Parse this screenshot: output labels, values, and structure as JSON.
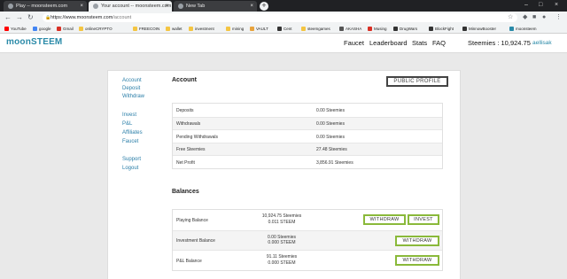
{
  "browser": {
    "tabs": [
      {
        "title": "Play -- moonsteem.com",
        "active": false
      },
      {
        "title": "Your account -- moonsteem.com",
        "active": true
      },
      {
        "title": "New Tab",
        "active": false
      }
    ],
    "url_host": "https://www.moonsteem.com",
    "url_path": "/account",
    "bookmarks": [
      {
        "label": "YouTube",
        "color": "#ff0000"
      },
      {
        "label": "google",
        "color": "#4285f4"
      },
      {
        "label": "Gmail",
        "color": "#d93025"
      },
      {
        "label": "onlineCRYPTO",
        "color": "#f4c542"
      },
      {
        "label": "FREECOIN",
        "color": "#f4c542"
      },
      {
        "label": "wallet",
        "color": "#f4c542"
      },
      {
        "label": "investment",
        "color": "#f4c542"
      },
      {
        "label": "mining",
        "color": "#f4c542"
      },
      {
        "label": "VAULT",
        "color": "#e8a33d"
      },
      {
        "label": "Cent",
        "color": "#333333"
      },
      {
        "label": "steemgames",
        "color": "#f4c542"
      },
      {
        "label": "AKASHA",
        "color": "#555555"
      },
      {
        "label": "Musing",
        "color": "#d93025"
      },
      {
        "label": "DrugWars",
        "color": "#333333"
      },
      {
        "label": "BlockFight",
        "color": "#333333"
      },
      {
        "label": "MinnowBooster",
        "color": "#333333"
      },
      {
        "label": "moonsteem",
        "color": "#2a8aa8"
      }
    ]
  },
  "site": {
    "logo": "moonSTEEM",
    "nav": [
      "Faucet",
      "Leaderboard",
      "Stats",
      "FAQ"
    ],
    "balance": "Steemies : 10,924.75",
    "username": "aellisak",
    "accent": "#2a8aa8"
  },
  "sidebar": {
    "group1": [
      "Account",
      "Deposit",
      "Withdraw"
    ],
    "group2": [
      "Invest",
      "P&L",
      "Affiliates",
      "Faucet"
    ],
    "group3": [
      "Support",
      "Logout"
    ]
  },
  "account": {
    "title": "Account",
    "public_profile": "PUBLIC PROFILE",
    "rows": [
      {
        "label": "Deposits",
        "value": "0.00 Steemies"
      },
      {
        "label": "Withdrawals",
        "value": "0.00 Steemies"
      },
      {
        "label": "Pending Withdrawals",
        "value": "0.00 Steemies"
      },
      {
        "label": "Free Steemies",
        "value": "27.48 Steemies"
      },
      {
        "label": "Net Profit",
        "value": "3,856.91 Steemies"
      }
    ]
  },
  "balances": {
    "title": "Balances",
    "rows": [
      {
        "label": "Playing Balance",
        "steemies": "10,924.75 Steemies",
        "steem": "0.011 STEEM",
        "buttons": [
          "WITHDRAW",
          "INVEST"
        ]
      },
      {
        "label": "Investment Balance",
        "steemies": "0.00 Steemies",
        "steem": "0.000 STEEM",
        "buttons": [
          "WITHDRAW"
        ]
      },
      {
        "label": "P&L Balance",
        "steemies": "91.11 Steemies",
        "steem": "0.000 STEEM",
        "buttons": [
          "WITHDRAW"
        ]
      }
    ]
  }
}
